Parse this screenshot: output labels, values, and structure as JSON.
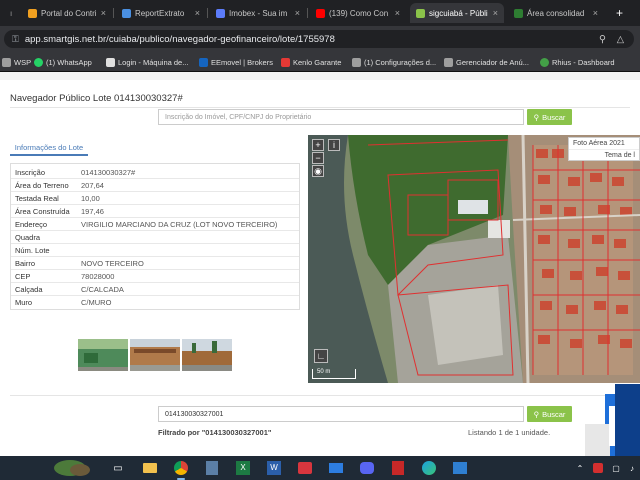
{
  "browser": {
    "tabs": [
      {
        "label": "Portal do Contri",
        "color": "#f0a020"
      },
      {
        "label": "ReportExtrato",
        "color": "#4a90e2"
      },
      {
        "label": "Imobex - Sua im",
        "color": "#5c7cfa"
      },
      {
        "label": "(139) Como Con",
        "color": "#ff0000"
      },
      {
        "label": "sigcuiabá - Públi",
        "color": "#8bc34a"
      },
      {
        "label": "Área consolidad",
        "color": "#2e7d32"
      }
    ],
    "new_tab": "+",
    "url": "app.smartgis.net.br/cuiaba/publico/navegador-geofinanceiro/lote/1755978",
    "bookmarks": [
      {
        "label": "WSP",
        "color": "#9e9e9e"
      },
      {
        "label": "(1) WhatsApp",
        "color": "#25d366"
      },
      {
        "label": "Login - Máquina de...",
        "color": "#e0e0e0"
      },
      {
        "label": "EEmovel | Brokers",
        "color": "#1565c0"
      },
      {
        "label": "Kenlo Garante",
        "color": "#e53935"
      },
      {
        "label": "(1) Configurações d...",
        "color": "#9e9e9e"
      },
      {
        "label": "Gerenciador de Anú...",
        "color": "#9e9e9e"
      },
      {
        "label": "Rhius - Dashboard",
        "color": "#43a047"
      }
    ]
  },
  "page": {
    "title": "Navegador Público Lote 014130030327#",
    "search_placeholder": "Inscrição do Imóvel, CPF/CNPJ do Proprietário",
    "buscar_label": "Buscar",
    "info_tab": "Informações do Lote",
    "info_rows": [
      {
        "key": "Inscrição",
        "value": "014130030327#"
      },
      {
        "key": "Área do Terreno",
        "value": "207,64"
      },
      {
        "key": "Testada Real",
        "value": "10,00"
      },
      {
        "key": "Área Construída",
        "value": "197,46"
      },
      {
        "key": "Endereço",
        "value": "VIRGILIO MARCIANO DA CRUZ (LOT NOVO TERCEIRO)"
      },
      {
        "key": "Quadra",
        "value": ""
      },
      {
        "key": "Núm. Lote",
        "value": ""
      },
      {
        "key": "Bairro",
        "value": "NOVO TERCEIRO"
      },
      {
        "key": "CEP",
        "value": "78028000"
      },
      {
        "key": "Calçada",
        "value": "C/CALCADA"
      },
      {
        "key": "Muro",
        "value": "C/MURO"
      }
    ],
    "map": {
      "layer1": "Foto Aérea 2021",
      "layer2": "Tema de l",
      "zoom_in": "+",
      "zoom_out": "−",
      "info": "i",
      "scale": "50 m"
    },
    "bottom_search_value": "014130030327001",
    "filter_text": "Filtrado por \"014130030327001\"",
    "listing_text": "Listando 1 de 1 unidade."
  },
  "colors": {
    "accent_green": "#8bc34a",
    "tab_blue": "#4a7bb7",
    "chrome_dark": "#202124"
  }
}
